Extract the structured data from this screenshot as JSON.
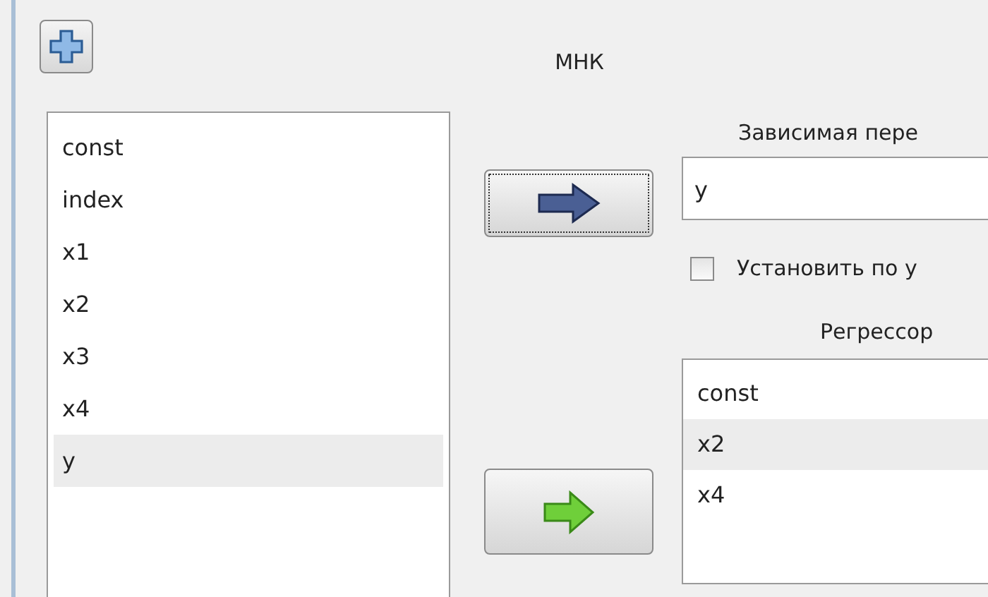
{
  "title": "МНК",
  "variables": [
    {
      "label": "const",
      "selected": false
    },
    {
      "label": "index",
      "selected": false
    },
    {
      "label": "x1",
      "selected": false
    },
    {
      "label": "x2",
      "selected": false
    },
    {
      "label": "x3",
      "selected": false
    },
    {
      "label": "x4",
      "selected": false
    },
    {
      "label": "y",
      "selected": true
    }
  ],
  "dependent": {
    "label": "Зависимая пере",
    "value": "y"
  },
  "set_checkbox": {
    "label": "Установить по у",
    "checked": false
  },
  "regressors": {
    "label": "Регрессор",
    "items": [
      {
        "label": "const",
        "selected": false
      },
      {
        "label": "x2",
        "selected": true
      },
      {
        "label": "x4",
        "selected": false
      }
    ]
  }
}
